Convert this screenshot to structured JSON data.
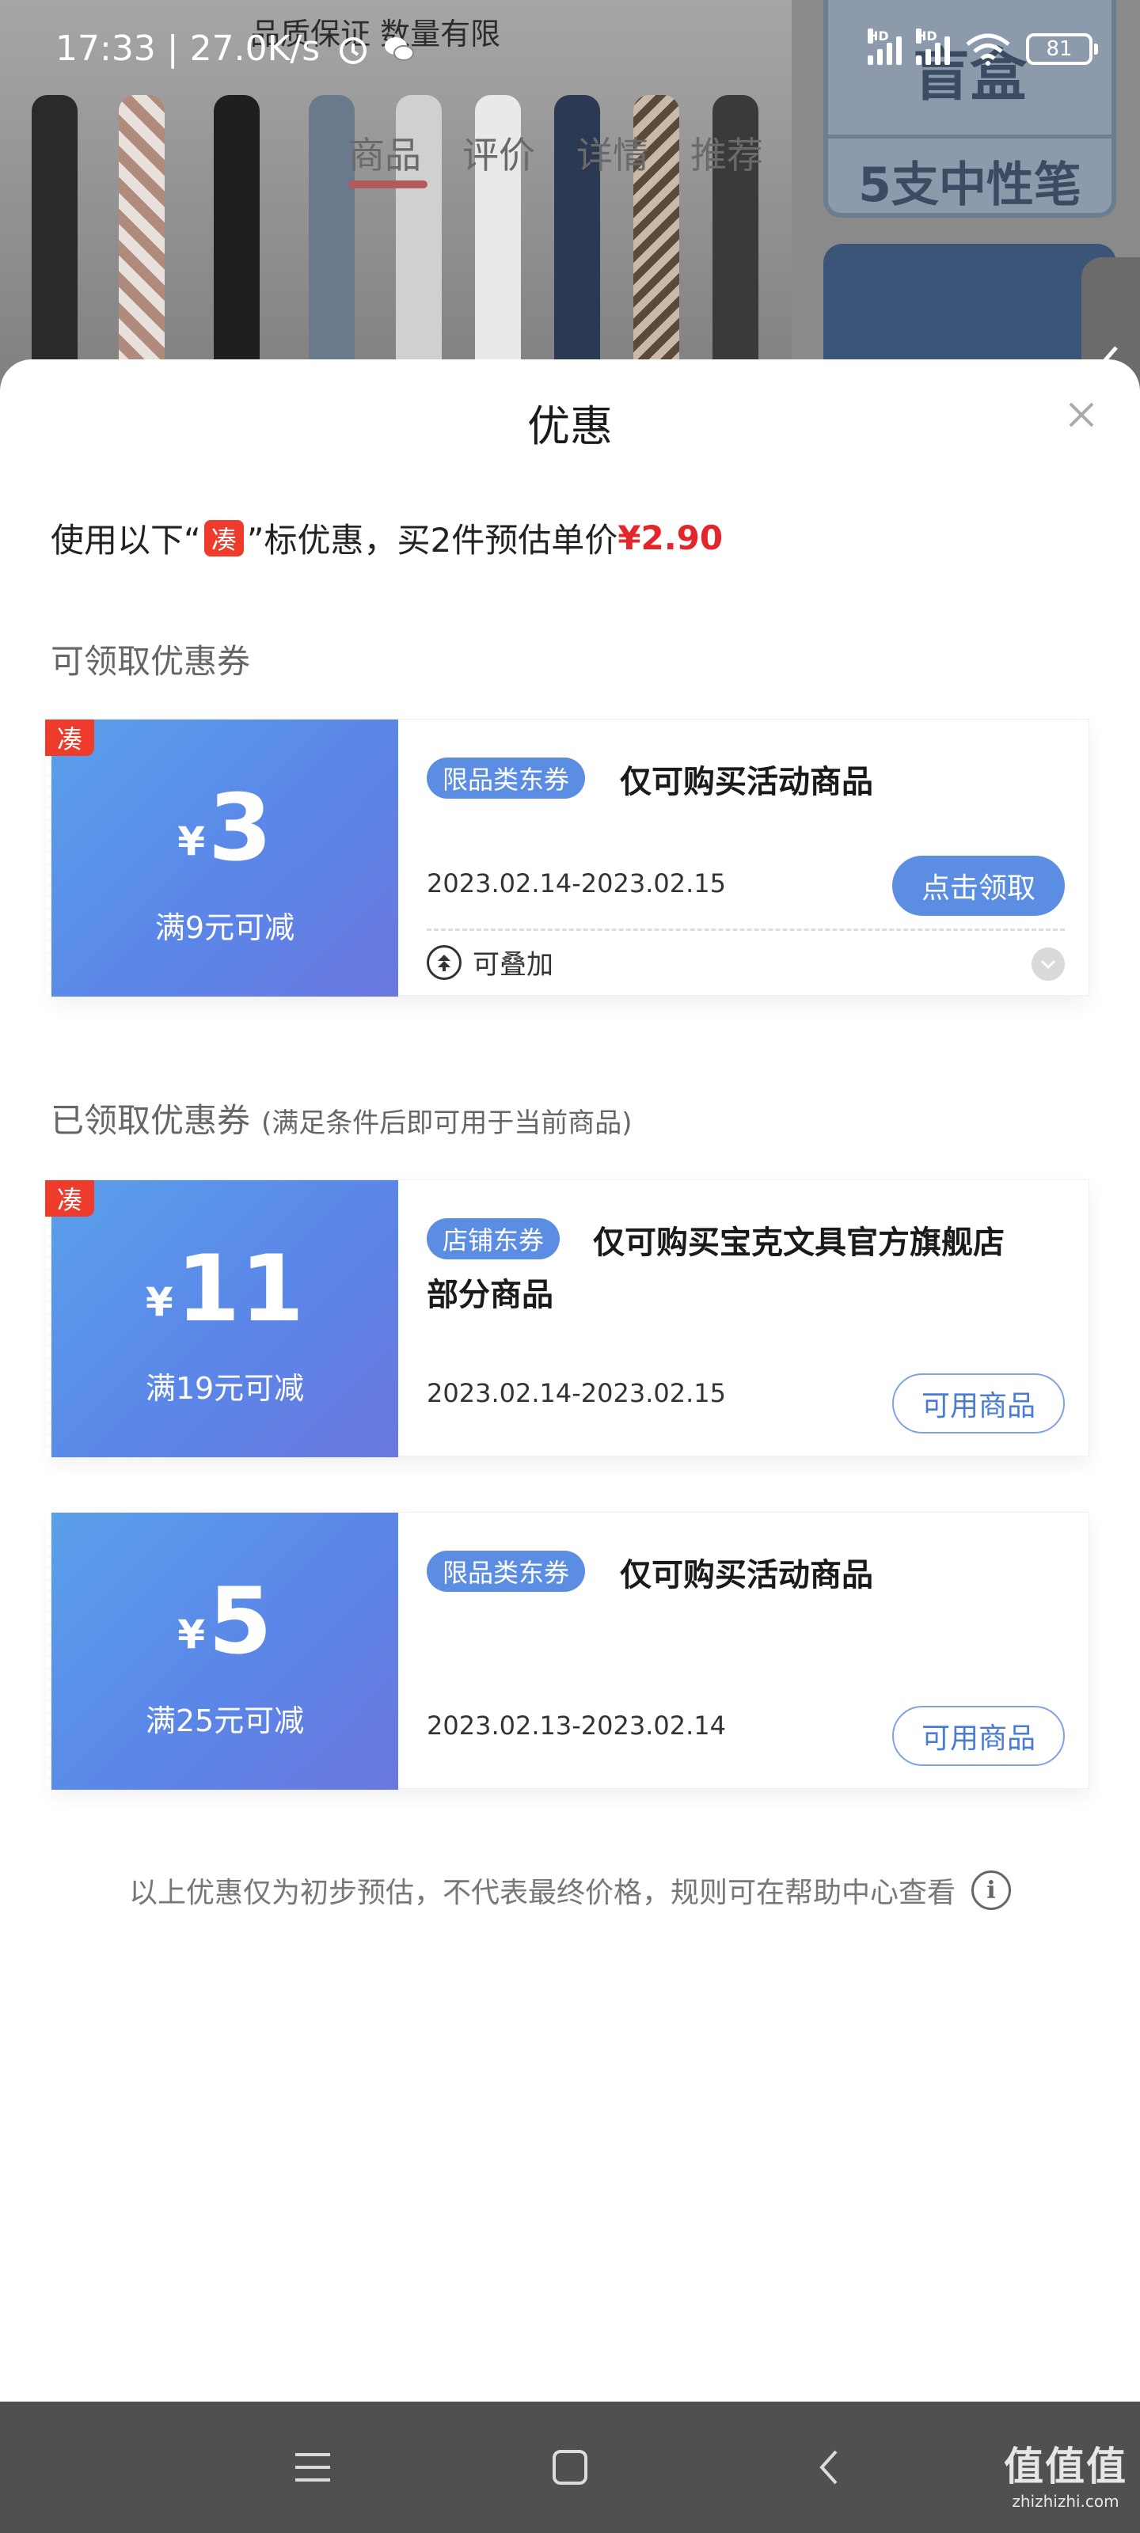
{
  "status_bar": {
    "time": "17:33",
    "speed": "27.0K/s",
    "hd_label": "HD",
    "battery": "81"
  },
  "background": {
    "tagline": "品质保证  数量有限",
    "tabs": [
      "商品",
      "评价",
      "详情",
      "推荐"
    ],
    "promo_top": "盲盒",
    "promo_caption": "5支中性笔"
  },
  "sheet": {
    "title": "优惠",
    "summary": {
      "prefix": "使用以下“",
      "tag": "凑",
      "suffix": "”标优惠，买2件预估单价",
      "price": "¥2.90"
    },
    "claimable": {
      "title": "可领取优惠券",
      "coupons": [
        {
          "tag": "凑",
          "currency": "¥",
          "amount": "3",
          "condition": "满9元可减",
          "type": "限品类东券",
          "description": "仅可购买活动商品",
          "dates": "2023.02.14-2023.02.15",
          "button": "点击领取",
          "stackable": "可叠加"
        }
      ]
    },
    "claimed": {
      "title": "已领取优惠券",
      "note": "(满足条件后即可用于当前商品)",
      "coupons": [
        {
          "tag": "凑",
          "currency": "¥",
          "amount": "11",
          "condition": "满19元可减",
          "type": "店铺东券",
          "description_line1": "仅可购买宝克文具官方旗舰店",
          "description_line2": "部分商品",
          "dates": "2023.02.14-2023.02.15",
          "button": "可用商品"
        },
        {
          "currency": "¥",
          "amount": "5",
          "condition": "满25元可减",
          "type": "限品类东券",
          "description": "仅可购买活动商品",
          "dates": "2023.02.13-2023.02.14",
          "button": "可用商品"
        }
      ]
    },
    "footer": "以上优惠仅为初步预估，不代表最终价格，规则可在帮助中心查看"
  },
  "watermark": {
    "big": "值值值",
    "small": "zhizhizhi.com"
  },
  "icons": {
    "close": "close-icon",
    "info": "info-icon",
    "stack": "stack-icon",
    "expand": "chevron-down-icon",
    "menu": "menu-icon",
    "home": "home-icon",
    "back": "back-icon"
  },
  "colors": {
    "accent_blue": "#5b8de3",
    "price_red": "#e4262a",
    "tag_red": "#ee3b2b"
  }
}
